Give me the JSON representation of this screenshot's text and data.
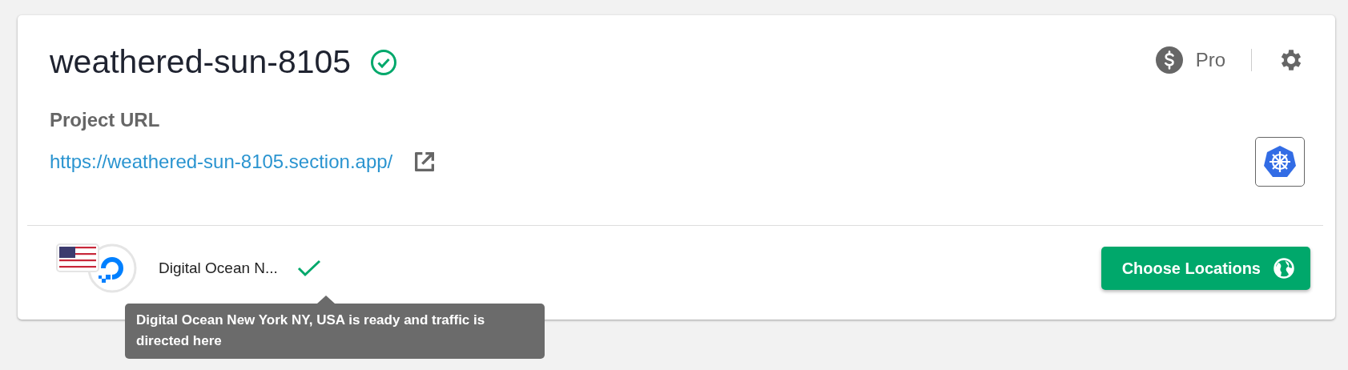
{
  "project": {
    "name": "weathered-sun-8105",
    "verified": true,
    "plan": "Pro",
    "url_label": "Project URL",
    "url": "https://weathered-sun-8105.section.app/"
  },
  "locations": [
    {
      "name": "Digital Ocean N...",
      "ready": true,
      "tooltip": "Digital Ocean New York NY, USA is ready and traffic is directed here"
    }
  ],
  "choose_button": {
    "label": "Choose Locations"
  }
}
